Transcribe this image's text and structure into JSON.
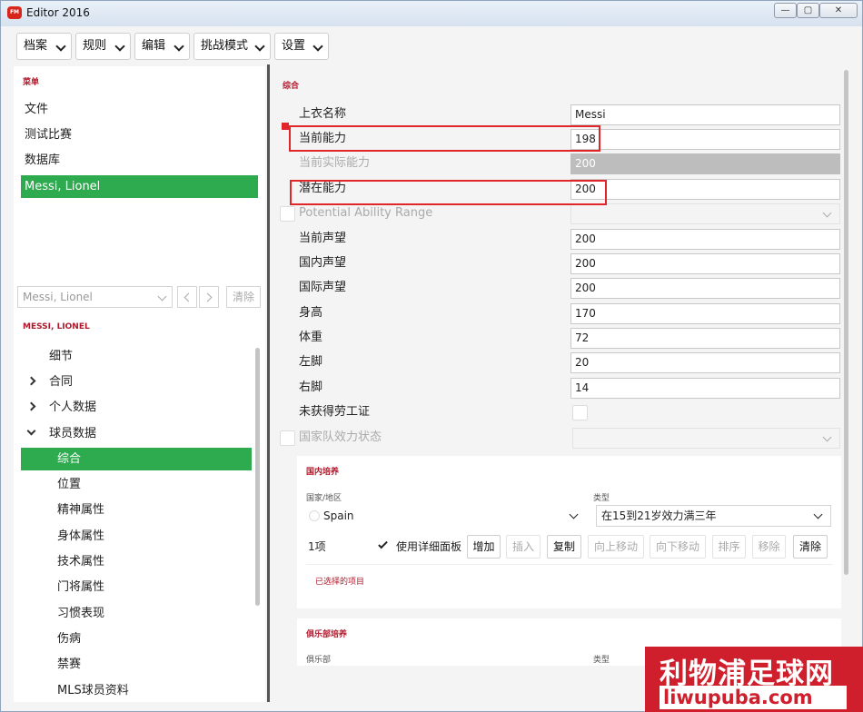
{
  "window": {
    "title": "Editor 2016",
    "app_icon_text": "FM",
    "controls": {
      "minimize": "—",
      "maximize": "▢",
      "close": "✕"
    }
  },
  "menubar": [
    "档案",
    "规则",
    "编辑",
    "挑战模式",
    "设置"
  ],
  "sidebar": {
    "menu_label": "菜单",
    "items": [
      "文件",
      "测试比赛",
      "数据库",
      "Messi, Lionel"
    ],
    "active_item": "Messi, Lionel"
  },
  "search": {
    "value": "Messi, Lionel",
    "clear_label": "清除"
  },
  "player": {
    "header": "MESSI, LIONEL",
    "tree": [
      {
        "label": "细节",
        "arrow": "none"
      },
      {
        "label": "合同",
        "arrow": "collapsed"
      },
      {
        "label": "个人数据",
        "arrow": "collapsed"
      },
      {
        "label": "球员数据",
        "arrow": "expanded"
      },
      {
        "label": "综合",
        "arrow": "child",
        "active": true
      },
      {
        "label": "位置",
        "arrow": "child"
      },
      {
        "label": "精神属性",
        "arrow": "child"
      },
      {
        "label": "身体属性",
        "arrow": "child"
      },
      {
        "label": "技术属性",
        "arrow": "child"
      },
      {
        "label": "门将属性",
        "arrow": "child"
      },
      {
        "label": "习惯表现",
        "arrow": "child"
      },
      {
        "label": "伤病",
        "arrow": "child"
      },
      {
        "label": "禁赛",
        "arrow": "child"
      },
      {
        "label": "MLS球员资料",
        "arrow": "child"
      }
    ]
  },
  "main": {
    "section_title": "综合",
    "fields": [
      {
        "label": "上衣名称",
        "value": "Messi",
        "state": "normal"
      },
      {
        "label": "当前能力",
        "value": "198",
        "state": "normal",
        "highlight": true
      },
      {
        "label": "当前实际能力",
        "value": "200",
        "state": "disabled"
      },
      {
        "label": "潜在能力",
        "value": "200",
        "state": "normal",
        "highlight": true
      },
      {
        "label": "Potential Ability Range",
        "value": "",
        "state": "dropdown-disabled"
      },
      {
        "label": "当前声望",
        "value": "200",
        "state": "normal"
      },
      {
        "label": "国内声望",
        "value": "200",
        "state": "normal"
      },
      {
        "label": "国际声望",
        "value": "200",
        "state": "normal"
      },
      {
        "label": "身高",
        "value": "170",
        "state": "normal"
      },
      {
        "label": "体重",
        "value": "72",
        "state": "normal"
      },
      {
        "label": "左脚",
        "value": "20",
        "state": "normal"
      },
      {
        "label": "右脚",
        "value": "14",
        "state": "normal"
      },
      {
        "label": "未获得劳工证",
        "value": "",
        "state": "checkbox"
      },
      {
        "label": "国家队效力状态",
        "value": "",
        "state": "dropdown-disabled"
      }
    ],
    "home_grown": {
      "title": "国内培养",
      "country_label": "国家/地区",
      "type_label": "类型",
      "country_value": "Spain",
      "type_value": "在15到21岁效力满三年",
      "count": "1项",
      "detail_checkbox_label": "使用详细面板",
      "buttons": [
        "增加",
        "插入",
        "复制",
        "向上移动",
        "向下移动",
        "排序",
        "移除",
        "清除"
      ],
      "selected_label": "已选择的项目"
    },
    "club_grown": {
      "title": "俱乐部培养",
      "club_label": "俱乐部",
      "type_label": "类型"
    }
  },
  "watermark": {
    "text": "利物浦足球网",
    "url": "liwupuba.com"
  },
  "colors": {
    "accent_green": "#2eaa4f",
    "label_red": "#b0182b",
    "highlight_red": "#e0262b",
    "watermark_red": "#cf1f2c"
  }
}
